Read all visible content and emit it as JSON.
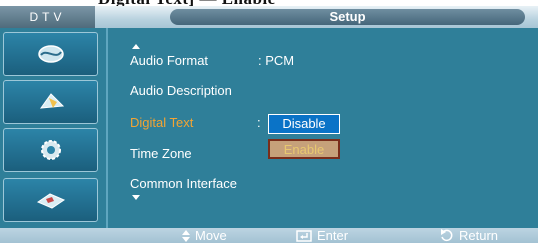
{
  "top_left_caption": "Digital Text] — Enable",
  "header": {
    "mode_label": "DTV",
    "title": "Setup"
  },
  "sidebar": {
    "icons": [
      "picture-icon",
      "sound-icon",
      "setup-icon",
      "input-icon"
    ]
  },
  "menu": {
    "items": [
      {
        "label": "Audio Format",
        "value": ": PCM"
      },
      {
        "label": "Audio Description"
      },
      {
        "label": "Digital Text",
        "value": ":",
        "selected": true
      },
      {
        "label": "Time Zone"
      },
      {
        "label": "Common Interface"
      }
    ],
    "popup_options": [
      "Disable",
      "Enable"
    ]
  },
  "footer": {
    "move": "Move",
    "enter": "Enter",
    "return": "Return"
  },
  "colors": {
    "panel": "#2f7f99",
    "selected_label": "#f2a433",
    "highlight_option": "#0a73c7",
    "dim_option": "#c6a17a"
  }
}
